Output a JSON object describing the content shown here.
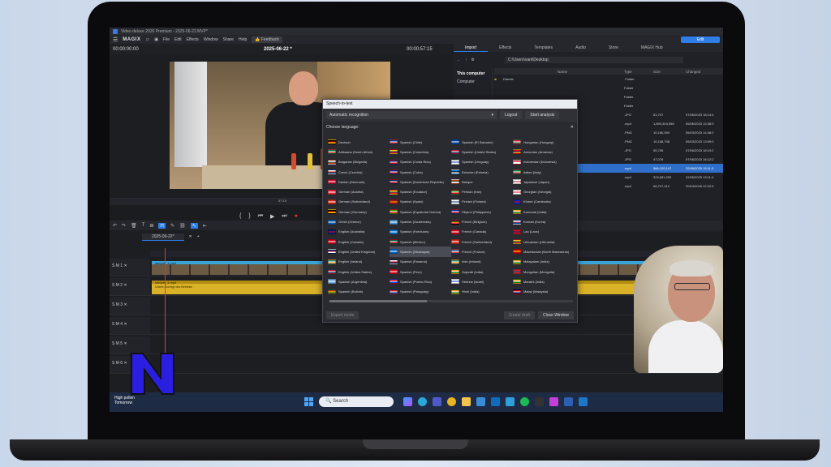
{
  "window": {
    "title": "Video deluxe 2026 Premium - 2025-06-22.MVP*",
    "brand": "MAGIX",
    "menu": [
      "File",
      "Edit",
      "Effects",
      "Window",
      "Share",
      "Help"
    ],
    "feedback": "Feedback",
    "edit_button": "Edit"
  },
  "preview": {
    "timecode_left": "00:00:00:00",
    "project_title": "2025-06-22 *",
    "timecode_right": "00:00:57:15",
    "ruler_label": "57:15"
  },
  "right_panel": {
    "tabs": [
      "Import",
      "Effects",
      "Templates",
      "Audio",
      "Store",
      "MAGIX Hub"
    ],
    "active_tab": "Import",
    "path": "C:\\Users\\vani\\Desktop",
    "sidebar_title": "This computer",
    "sidebar_item": "Computer",
    "columns": [
      "Name",
      "Type",
      "Size",
      "Changed"
    ],
    "rows": [
      {
        "name": "Dannie",
        "type": "Folder",
        "size": "",
        "changed": ""
      },
      {
        "name": "",
        "type": "Folder",
        "size": "",
        "changed": ""
      },
      {
        "name": "",
        "type": "Folder",
        "size": "",
        "changed": ""
      },
      {
        "name": "",
        "type": "Folder",
        "size": "",
        "changed": ""
      },
      {
        "name": "",
        "type": ".JPG",
        "size": "61,797",
        "changed": "07/06/2023 18:14:4"
      },
      {
        "name": "",
        "type": ".mp4",
        "size": "1,899,304,958",
        "changed": "06/06/2023 13:38:0"
      },
      {
        "name": "",
        "type": ".PNG",
        "size": "10,180,593",
        "changed": "05/03/2023 14:48:2"
      },
      {
        "name": "",
        "type": ".PNG",
        "size": "10,168,708",
        "changed": "05/03/2023 13:59:0"
      },
      {
        "name": "",
        "type": ".JPG",
        "size": "95,705",
        "changed": "07/06/2023 18:13:2"
      },
      {
        "name": "",
        "type": ".JPG",
        "size": "47,078",
        "changed": "07/06/2023 18:12:2"
      },
      {
        "name": "",
        "type": ".mp4",
        "size": "566,120,147",
        "changed": "22/06/2025 15:11:3"
      },
      {
        "name": "",
        "type": ".mp4",
        "size": "324,081,039",
        "changed": "22/06/2025 13:11:4"
      },
      {
        "name": "",
        "type": ".mp4",
        "size": "66,727,412",
        "changed": "20/04/2025 22:22:5"
      }
    ],
    "selected_row": 10
  },
  "timeline": {
    "tab_label": "2025-06-22*",
    "tracks": [
      {
        "num": "1",
        "clip": "sample_1.mp4",
        "kind": "video"
      },
      {
        "num": "2",
        "clip": "sample_1.mp4",
        "sub": "Untere Anzeige des Betriebs",
        "kind": "audio"
      },
      {
        "num": "3",
        "kind": "empty"
      },
      {
        "num": "4",
        "kind": "empty"
      },
      {
        "num": "5",
        "kind": "empty"
      },
      {
        "num": "6",
        "kind": "empty"
      }
    ]
  },
  "dialog": {
    "title": "Speech-to-text",
    "recognition": "Automatic recognition",
    "logout": "Logout",
    "start": "Start analysis",
    "choose": "Choose language:",
    "languages": [
      {
        "name": "Deutsch",
        "c": [
          "#000",
          "#d00",
          "#fc0"
        ]
      },
      {
        "name": "Afrikaans (South Africa)",
        "c": [
          "#007a4d",
          "#fff",
          "#de3831"
        ]
      },
      {
        "name": "Bulgarian (Bulgaria)",
        "c": [
          "#fff",
          "#00966e",
          "#d62612"
        ]
      },
      {
        "name": "Czech (Czechia)",
        "c": [
          "#fff",
          "#d7141a",
          "#11457e"
        ]
      },
      {
        "name": "Danish (Denmark)",
        "c": [
          "#c8102e",
          "#fff",
          "#c8102e"
        ]
      },
      {
        "name": "German (Austria)",
        "c": [
          "#ed2939",
          "#fff",
          "#ed2939"
        ]
      },
      {
        "name": "German (Switzerland)",
        "c": [
          "#d52b1e",
          "#fff",
          "#d52b1e"
        ]
      },
      {
        "name": "German (Germany)",
        "c": [
          "#000",
          "#d00",
          "#fc0"
        ]
      },
      {
        "name": "Greek (Greece)",
        "c": [
          "#0d5eaf",
          "#fff",
          "#0d5eaf"
        ]
      },
      {
        "name": "English (Australia)",
        "c": [
          "#012169",
          "#e4002b",
          "#012169"
        ]
      },
      {
        "name": "English (Canada)",
        "c": [
          "#d80621",
          "#fff",
          "#d80621"
        ]
      },
      {
        "name": "English (United Kingdom)",
        "c": [
          "#012169",
          "#c8102e",
          "#fff"
        ]
      },
      {
        "name": "English (Ireland)",
        "c": [
          "#169b62",
          "#fff",
          "#ff883e"
        ]
      },
      {
        "name": "English (United States)",
        "c": [
          "#b22234",
          "#fff",
          "#3c3b6e"
        ]
      },
      {
        "name": "Spanish (Argentina)",
        "c": [
          "#74acdf",
          "#fff",
          "#74acdf"
        ]
      },
      {
        "name": "Spanish (Bolivia)",
        "c": [
          "#d52b1e",
          "#f9e300",
          "#007934"
        ]
      },
      {
        "name": "Spanish (Chile)",
        "c": [
          "#0039a6",
          "#fff",
          "#d52b1e"
        ]
      },
      {
        "name": "Spanish (Colombia)",
        "c": [
          "#fcd116",
          "#003893",
          "#ce1126"
        ]
      },
      {
        "name": "Spanish (Costa Rica)",
        "c": [
          "#002b7f",
          "#fff",
          "#ce1126"
        ]
      },
      {
        "name": "Spanish (Cuba)",
        "c": [
          "#002a8f",
          "#fff",
          "#cf142b"
        ]
      },
      {
        "name": "Spanish (Dominican Republic)",
        "c": [
          "#002d62",
          "#fff",
          "#ce1126"
        ]
      },
      {
        "name": "Spanish (Ecuador)",
        "c": [
          "#ffdd00",
          "#034ea2",
          "#ed1c24"
        ]
      },
      {
        "name": "Spanish (Spain)",
        "c": [
          "#aa151b",
          "#f1bf00",
          "#aa151b"
        ]
      },
      {
        "name": "Spanish (Equatorial Guinea)",
        "c": [
          "#3e9a00",
          "#fff",
          "#e32118"
        ]
      },
      {
        "name": "Spanish (Guatemala)",
        "c": [
          "#4997d0",
          "#fff",
          "#4997d0"
        ]
      },
      {
        "name": "Spanish (Honduras)",
        "c": [
          "#0073cf",
          "#fff",
          "#0073cf"
        ]
      },
      {
        "name": "Spanish (Mexico)",
        "c": [
          "#006847",
          "#fff",
          "#ce1126"
        ]
      },
      {
        "name": "Spanish (Nicaragua)",
        "c": [
          "#0067c6",
          "#fff",
          "#0067c6"
        ]
      },
      {
        "name": "Spanish (Panama)",
        "c": [
          "#fff",
          "#da121a",
          "#072357"
        ]
      },
      {
        "name": "Spanish (Peru)",
        "c": [
          "#d91023",
          "#fff",
          "#d91023"
        ]
      },
      {
        "name": "Spanish (Puerto Rico)",
        "c": [
          "#ed0000",
          "#fff",
          "#0050f0"
        ]
      },
      {
        "name": "Spanish (Paraguay)",
        "c": [
          "#d52b1e",
          "#fff",
          "#0038a8"
        ]
      },
      {
        "name": "Spanish (El Salvador)",
        "c": [
          "#0047ab",
          "#fff",
          "#0047ab"
        ]
      },
      {
        "name": "Spanish (United States)",
        "c": [
          "#b22234",
          "#fff",
          "#3c3b6e"
        ]
      },
      {
        "name": "Spanish (Uruguay)",
        "c": [
          "#fff",
          "#0038a8",
          "#fff"
        ]
      },
      {
        "name": "Estonian (Estonia)",
        "c": [
          "#0072ce",
          "#000",
          "#fff"
        ]
      },
      {
        "name": "Basque",
        "c": [
          "#d52b1e",
          "#009b48",
          "#fff"
        ]
      },
      {
        "name": "Persian (Iran)",
        "c": [
          "#239f40",
          "#fff",
          "#da0000"
        ]
      },
      {
        "name": "Finnish (Finland)",
        "c": [
          "#fff",
          "#002f6c",
          "#fff"
        ]
      },
      {
        "name": "Filipino (Philippines)",
        "c": [
          "#0038a8",
          "#fff",
          "#ce1126"
        ]
      },
      {
        "name": "French (Belgium)",
        "c": [
          "#000",
          "#fdda24",
          "#ef3340"
        ]
      },
      {
        "name": "French (Canada)",
        "c": [
          "#d80621",
          "#fff",
          "#d80621"
        ]
      },
      {
        "name": "French (Switzerland)",
        "c": [
          "#d52b1e",
          "#fff",
          "#d52b1e"
        ]
      },
      {
        "name": "French (France)",
        "c": [
          "#0055a4",
          "#fff",
          "#ef4135"
        ]
      },
      {
        "name": "Irish (Ireland)",
        "c": [
          "#169b62",
          "#fff",
          "#ff883e"
        ]
      },
      {
        "name": "Gujarati (India)",
        "c": [
          "#ff9933",
          "#fff",
          "#138808"
        ]
      },
      {
        "name": "Hebrew (Israel)",
        "c": [
          "#fff",
          "#0038b8",
          "#fff"
        ]
      },
      {
        "name": "Hindi (India)",
        "c": [
          "#ff9933",
          "#fff",
          "#138808"
        ]
      },
      {
        "name": "Hungarian (Hungary)",
        "c": [
          "#ce2939",
          "#fff",
          "#477050"
        ]
      },
      {
        "name": "Armenian (Armenia)",
        "c": [
          "#d90012",
          "#0033a0",
          "#f2a800"
        ]
      },
      {
        "name": "Indonesian (Indonesia)",
        "c": [
          "#ce1126",
          "#fff",
          "#fff"
        ]
      },
      {
        "name": "Italian (Italy)",
        "c": [
          "#009246",
          "#fff",
          "#ce2b37"
        ]
      },
      {
        "name": "Japanese (Japan)",
        "c": [
          "#fff",
          "#bc002d",
          "#fff"
        ]
      },
      {
        "name": "Georgian (Georgia)",
        "c": [
          "#fff",
          "#e8112d",
          "#fff"
        ]
      },
      {
        "name": "Khmer (Cambodia)",
        "c": [
          "#032ea1",
          "#e00025",
          "#032ea1"
        ]
      },
      {
        "name": "Kannada (India)",
        "c": [
          "#ff9933",
          "#fff",
          "#138808"
        ]
      },
      {
        "name": "Korean (Korea)",
        "c": [
          "#fff",
          "#cd2e3a",
          "#0047a0"
        ]
      },
      {
        "name": "Lao (Laos)",
        "c": [
          "#ce1126",
          "#002868",
          "#ce1126"
        ]
      },
      {
        "name": "Lithuanian (Lithuania)",
        "c": [
          "#fdb913",
          "#006a44",
          "#c1272d"
        ]
      },
      {
        "name": "Macedonian (North Macedonia)",
        "c": [
          "#d20000",
          "#ffe600",
          "#d20000"
        ]
      },
      {
        "name": "Malayalam (India)",
        "c": [
          "#ff9933",
          "#fff",
          "#138808"
        ]
      },
      {
        "name": "Mongolian (Mongolia)",
        "c": [
          "#c4272f",
          "#015197",
          "#c4272f"
        ]
      },
      {
        "name": "Marathi (India)",
        "c": [
          "#ff9933",
          "#fff",
          "#138808"
        ]
      },
      {
        "name": "Malay (Malaysia)",
        "c": [
          "#cc0001",
          "#fff",
          "#010066"
        ]
      }
    ],
    "highlight_index": 27,
    "footer": [
      "Expert mode",
      "Create draft",
      "Close Window"
    ]
  },
  "taskbar": {
    "weather_line1": "High pollen",
    "weather_line2": "Tomorrow",
    "search_placeholder": "Search"
  },
  "overlay_logo": "N"
}
